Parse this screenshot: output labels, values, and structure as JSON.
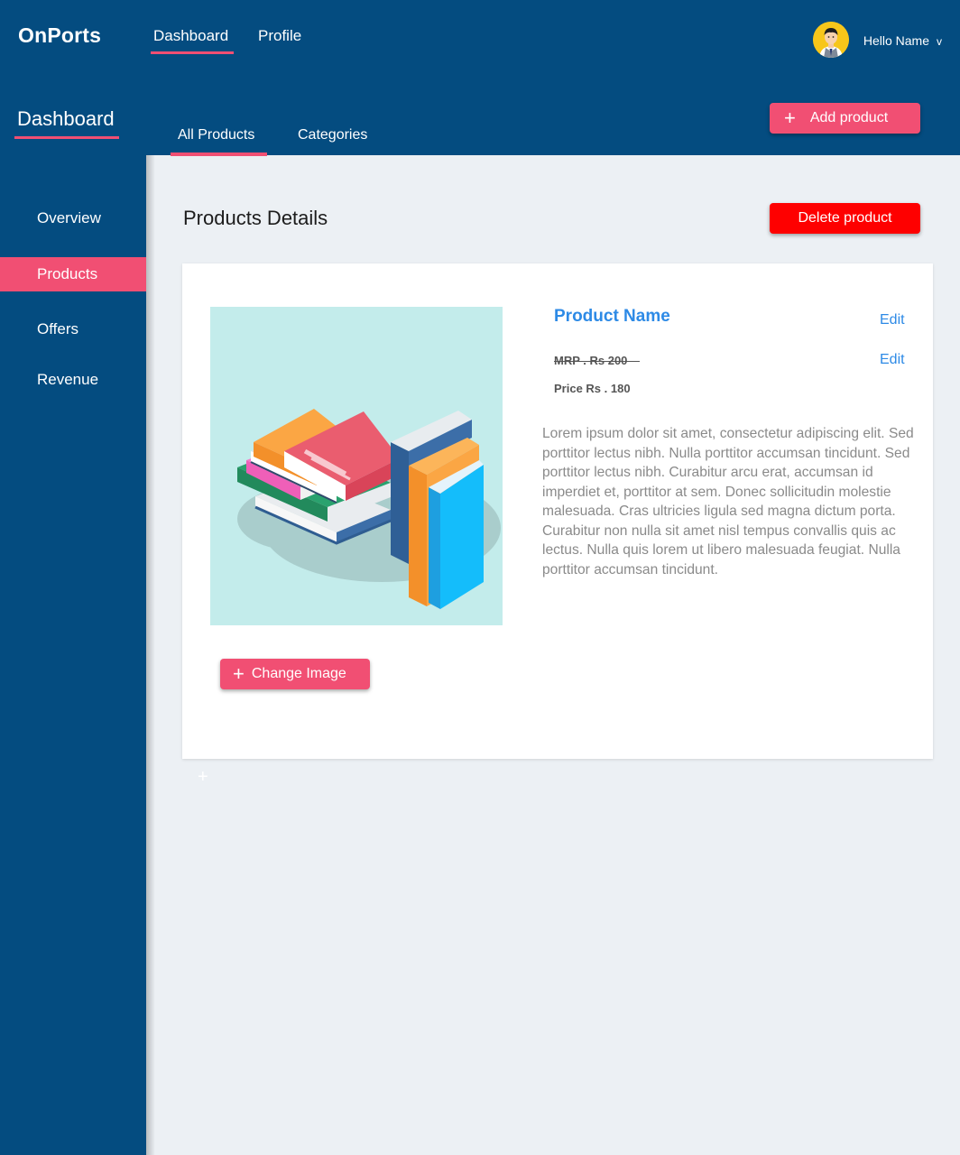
{
  "app": {
    "brand": "OnPorts"
  },
  "topnav": {
    "items": [
      {
        "label": "Dashboard",
        "active": true
      },
      {
        "label": "Profile",
        "active": false
      }
    ]
  },
  "user": {
    "greeting": "Hello Name",
    "caret": "v"
  },
  "section": {
    "title": "Dashboard"
  },
  "subtabs": [
    {
      "label": "All Products",
      "active": true
    },
    {
      "label": "Categories",
      "active": false
    }
  ],
  "actions": {
    "add_product": "Add product",
    "delete_product": "Delete product",
    "change_image": "Change Image",
    "plus": "+"
  },
  "sidebar": {
    "items": [
      {
        "label": "Overview"
      },
      {
        "label": "Products",
        "active": true
      },
      {
        "label": "Offers"
      },
      {
        "label": "Revenue"
      }
    ]
  },
  "page": {
    "title": "Products Details"
  },
  "product": {
    "name": "Product Name",
    "mrp": "MRP . Rs 200",
    "price": "Price Rs . 180",
    "edit_label": "Edit",
    "description": "Lorem ipsum dolor sit amet, consectetur adipiscing elit. Sed porttitor lectus nibh. Nulla porttitor accumsan tincidunt. Sed porttitor lectus nibh. Curabitur arcu erat, accumsan id imperdiet et, porttitor at sem. Donec sollicitudin molestie malesuada. Cras ultricies ligula sed magna dictum porta. Curabitur non nulla sit amet nisl tempus convallis quis ac lectus. Nulla quis lorem ut libero malesuada feugiat. Nulla porttitor accumsan tincidunt."
  },
  "colors": {
    "primary": "#044c80",
    "accent": "#f14f73",
    "danger": "#fe0000",
    "link": "#2d8ae6",
    "background": "#ecf0f4"
  }
}
